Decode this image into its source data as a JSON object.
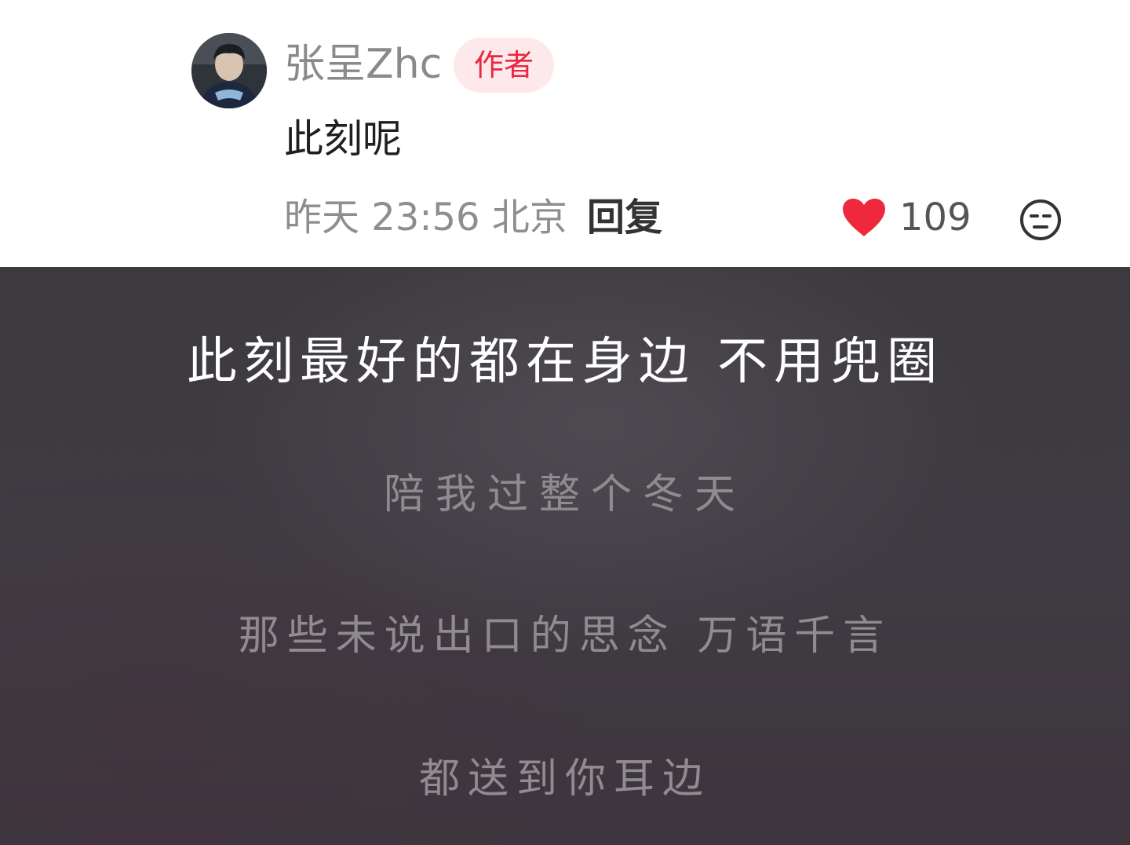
{
  "comment": {
    "username": "张呈Zhc",
    "badge": "作者",
    "text": "此刻呢",
    "time_location": "昨天 23:56 北京",
    "reply_label": "回复",
    "like_count": "109",
    "icons": {
      "like": "heart-icon",
      "emoji": "emoji-icon"
    },
    "colors": {
      "like_heart": "#f0283e",
      "badge_text": "#e8283f",
      "badge_bg": "#fde9ec"
    }
  },
  "lyrics": {
    "current_line": "此刻最好的都在身边 不用兜圈",
    "next_lines": [
      "陪我过整个冬天",
      "那些未说出口的思念 万语千言",
      "都送到你耳边"
    ],
    "colors": {
      "background": "#3e393f",
      "current_text": "#ffffff",
      "upcoming_text": "#8f8b90"
    }
  }
}
